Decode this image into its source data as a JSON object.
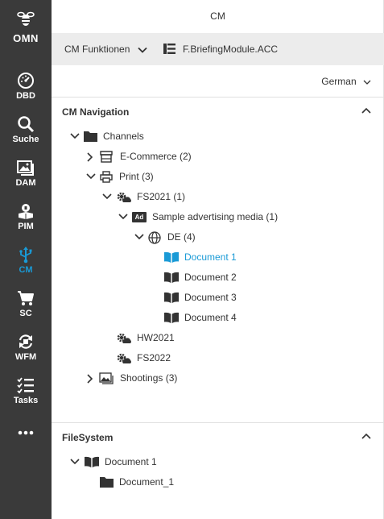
{
  "sidebar": {
    "logo": "OMN",
    "items": [
      {
        "label": "DBD",
        "icon": "dashboard-gauge-icon"
      },
      {
        "label": "Suche",
        "icon": "search-icon"
      },
      {
        "label": "DAM",
        "icon": "image-gallery-icon"
      },
      {
        "label": "PIM",
        "icon": "product-box-icon"
      },
      {
        "label": "CM",
        "icon": "usb-connector-icon",
        "active": true
      },
      {
        "label": "SC",
        "icon": "shopping-cart-icon"
      },
      {
        "label": "WFM",
        "icon": "workflow-cycle-icon"
      },
      {
        "label": "Tasks",
        "icon": "checklist-icon"
      },
      {
        "label": "",
        "icon": "more-dots-icon"
      }
    ]
  },
  "header": {
    "title": "CM"
  },
  "toolbar": {
    "functions_label": "CM Funktionen",
    "module_label": "F.BriefingModule.ACC"
  },
  "language": {
    "selected": "German"
  },
  "cm_navigation": {
    "title": "CM Navigation",
    "tree": {
      "channels": "Channels",
      "ecommerce": "E-Commerce (2)",
      "print": "Print (3)",
      "fs2021": "FS2021 (1)",
      "ad_badge": "Ad",
      "sample_media": "Sample advertising media (1)",
      "de": "DE (4)",
      "doc1": "Document 1",
      "doc2": "Document 2",
      "doc3": "Document 3",
      "doc4": "Document 4",
      "hw2021": "HW2021",
      "fs2022": "FS2022",
      "shootings": "Shootings (3)"
    }
  },
  "filesystem": {
    "title": "FileSystem",
    "document": "Document 1",
    "folder": "Document_1"
  },
  "colors": {
    "sidebar_bg": "#3a3a3a",
    "accent": "#1a9ad6",
    "toolbar_bg": "#ececec"
  }
}
